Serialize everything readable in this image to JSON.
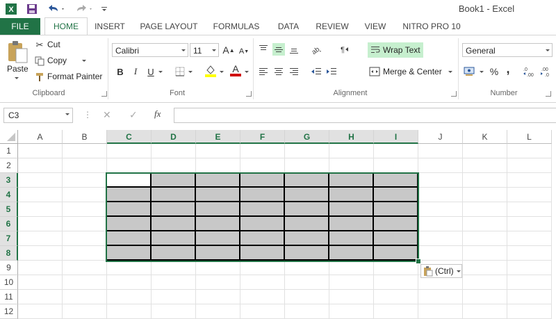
{
  "window": {
    "title": "Book1 - Excel"
  },
  "tabs": [
    "FILE",
    "HOME",
    "INSERT",
    "PAGE LAYOUT",
    "FORMULAS",
    "DATA",
    "REVIEW",
    "VIEW",
    "NITRO PRO 10"
  ],
  "clipboard": {
    "paste": "Paste",
    "cut": "Cut",
    "copy": "Copy",
    "format_painter": "Format Painter",
    "label": "Clipboard"
  },
  "font": {
    "name": "Calibri",
    "size": "11",
    "bold": "B",
    "italic": "I",
    "underline": "U",
    "grow": "A",
    "shrink": "A",
    "color_glyph": "A",
    "label": "Font"
  },
  "alignment": {
    "wrap_text": "Wrap Text",
    "merge_center": "Merge & Center",
    "label": "Alignment"
  },
  "number": {
    "format": "General",
    "percent": "%",
    "comma": ",",
    "label": "Number"
  },
  "formula_bar": {
    "name_box": "C3",
    "fx": "fx",
    "cancel": "✕",
    "enter": "✓",
    "content": ""
  },
  "columns": [
    "A",
    "B",
    "C",
    "D",
    "E",
    "F",
    "G",
    "H",
    "I",
    "J",
    "K",
    "L"
  ],
  "selected_columns": [
    "C",
    "D",
    "E",
    "F",
    "G",
    "H",
    "I"
  ],
  "rows": [
    "1",
    "2",
    "3",
    "4",
    "5",
    "6",
    "7",
    "8",
    "9",
    "10",
    "11",
    "12"
  ],
  "selected_rows": [
    "3",
    "4",
    "5",
    "6",
    "7",
    "8"
  ],
  "paste_options": {
    "label": "(Ctrl)"
  },
  "colors": {
    "accent": "#217346",
    "cell_fill": "#c8c8c8",
    "font_color": "#d00000",
    "highlight": "#ffff00"
  }
}
